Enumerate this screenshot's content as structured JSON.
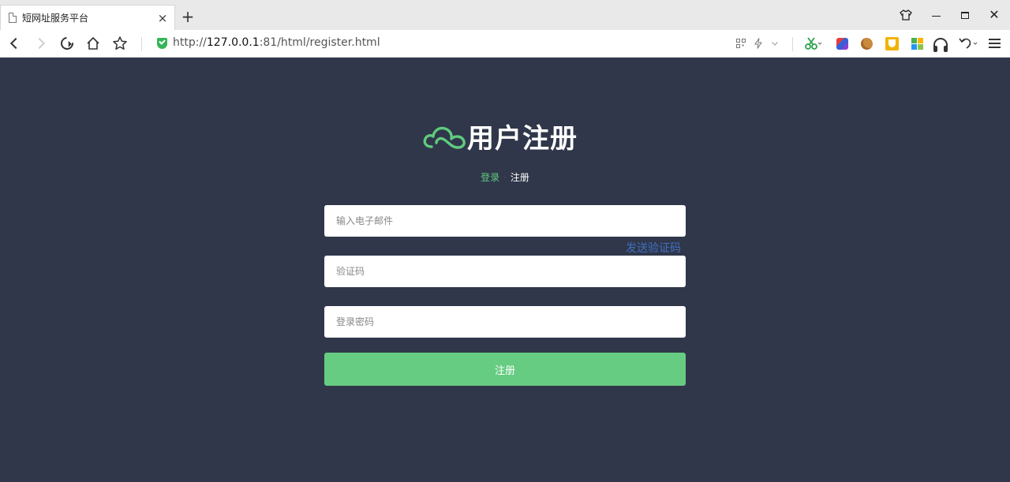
{
  "browser": {
    "tab_title": "短网址服务平台",
    "tab_close": "×",
    "new_tab": "+",
    "url_scheme": "http://",
    "url_host": "127.0.0.1",
    "url_rest": ":81/html/register.html",
    "close_glyph": "✕"
  },
  "page": {
    "title": "用户注册",
    "nav": {
      "login": "登录",
      "separator": "·",
      "register": "注册"
    },
    "email_placeholder": "输入电子邮件",
    "send_code": "发送验证码",
    "code_placeholder": "验证码",
    "password_placeholder": "登录密码",
    "submit_label": "注册"
  },
  "colors": {
    "background": "#30374a",
    "accent_green": "#66cc82",
    "link_blue": "#3f6fc2"
  },
  "icons": [
    "page-icon",
    "back-icon",
    "forward-icon",
    "reload-icon",
    "home-icon",
    "star-icon",
    "shield-icon",
    "cloud-icon",
    "menu-icon"
  ]
}
